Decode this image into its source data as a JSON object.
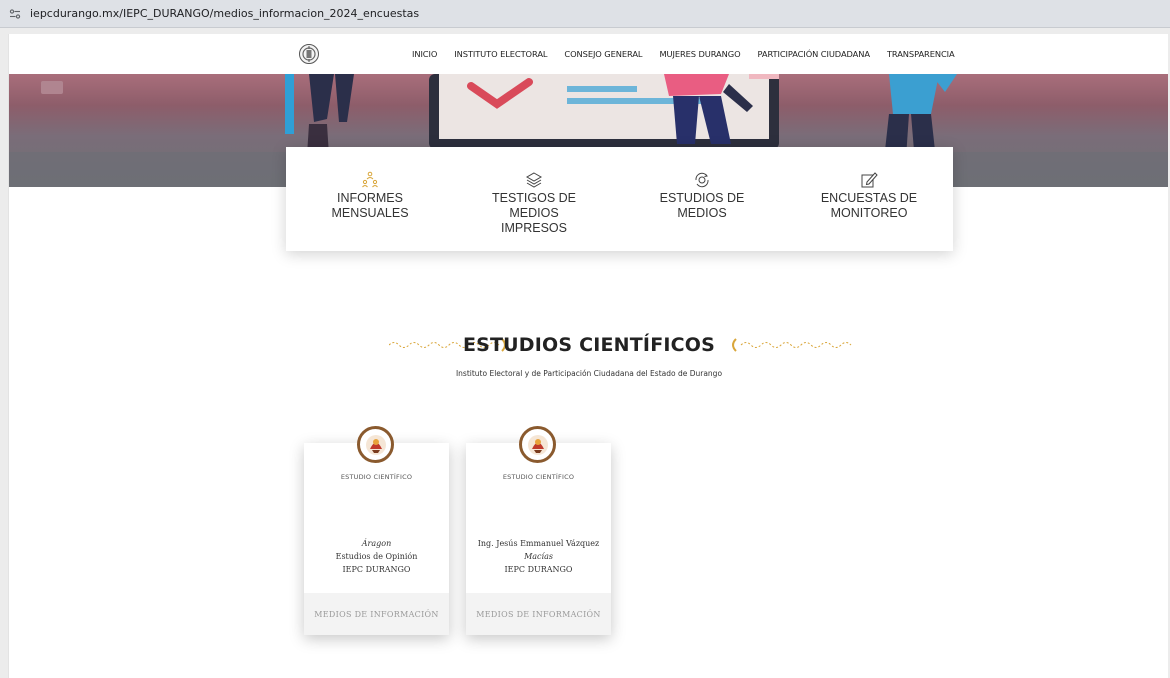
{
  "browser": {
    "url": "iepcdurango.mx/IEPC_DURANGO/medios_informacion_2024_encuestas"
  },
  "nav": {
    "items": [
      {
        "label": "INICIO"
      },
      {
        "label": "INSTITUTO ELECTORAL"
      },
      {
        "label": "CONSEJO GENERAL"
      },
      {
        "label": "MUJERES DURANGO"
      },
      {
        "label": "PARTICIPACIÓN CIUDADANA"
      },
      {
        "label": "TRANSPARENCIA"
      }
    ]
  },
  "categories": [
    {
      "line1": "INFORMES MENSUALES",
      "line2": "",
      "icon": "people-network-icon"
    },
    {
      "line1": "TESTIGOS DE MEDIOS",
      "line2": "IMPRESOS",
      "icon": "layers-icon"
    },
    {
      "line1": "ESTUDIOS DE MEDIOS",
      "line2": "",
      "icon": "coin-refresh-icon"
    },
    {
      "line1": "ENCUESTAS DE",
      "line2": "MONITOREO",
      "icon": "edit-icon"
    }
  ],
  "section": {
    "title": "ESTUDIOS CIENTÍFICOS",
    "subtitle": "Instituto Electoral y de Participación Ciudadana del Estado de Durango"
  },
  "studies": [
    {
      "header": "ESTUDIO CIENTÍFICO",
      "line1": "Áragon",
      "line2": "Estudios de Opinión",
      "line3": "IEPC DURANGO",
      "footer": "MEDIOS DE INFORMACIÓN"
    },
    {
      "header": "ESTUDIO CIENTÍFICO",
      "line1": "Ing. Jesús Emmanuel Vázquez",
      "line2": "Macías",
      "line3": "IEPC DURANGO",
      "footer": "MEDIOS DE INFORMACIÓN"
    }
  ],
  "colors": {
    "accent_gold": "#d9a63a",
    "avatar_ring": "#8a5a2e"
  }
}
